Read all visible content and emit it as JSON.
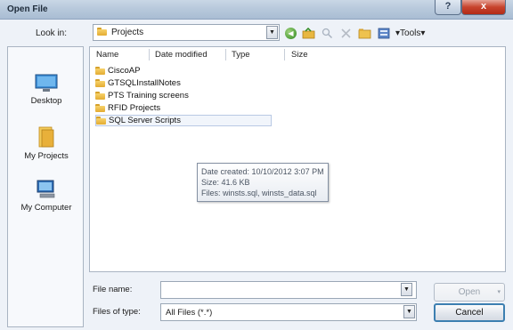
{
  "window": {
    "title": "Open File",
    "help_label": "?",
    "close_label": "x"
  },
  "lookin": {
    "label": "Look in:",
    "value": "Projects"
  },
  "toolbar": {
    "tools_label": "Tools"
  },
  "places": [
    {
      "label": "Desktop"
    },
    {
      "label": "My Projects"
    },
    {
      "label": "My Computer"
    }
  ],
  "columns": [
    "Name",
    "Date modified",
    "Type",
    "Size"
  ],
  "files": [
    {
      "name": "CiscoAP"
    },
    {
      "name": "GTSQLInstallNotes"
    },
    {
      "name": "PTS Training screens"
    },
    {
      "name": "RFID Projects"
    },
    {
      "name": "SQL Server Scripts"
    }
  ],
  "tooltip": {
    "date": "Date created: 10/10/2012 3:07 PM",
    "size": "Size: 41.6 KB",
    "files": "Files: winsts.sql, winsts_data.sql"
  },
  "filename": {
    "label": "File name:",
    "value": ""
  },
  "filetype": {
    "label": "Files of type:",
    "value": "All Files (*.*)"
  },
  "buttons": {
    "open": "Open",
    "cancel": "Cancel"
  },
  "colors": {
    "titlebar": "#b8c9dc",
    "dialog_bg": "#eef2f8",
    "close": "#c7432d",
    "folder": "#e3ab32"
  }
}
